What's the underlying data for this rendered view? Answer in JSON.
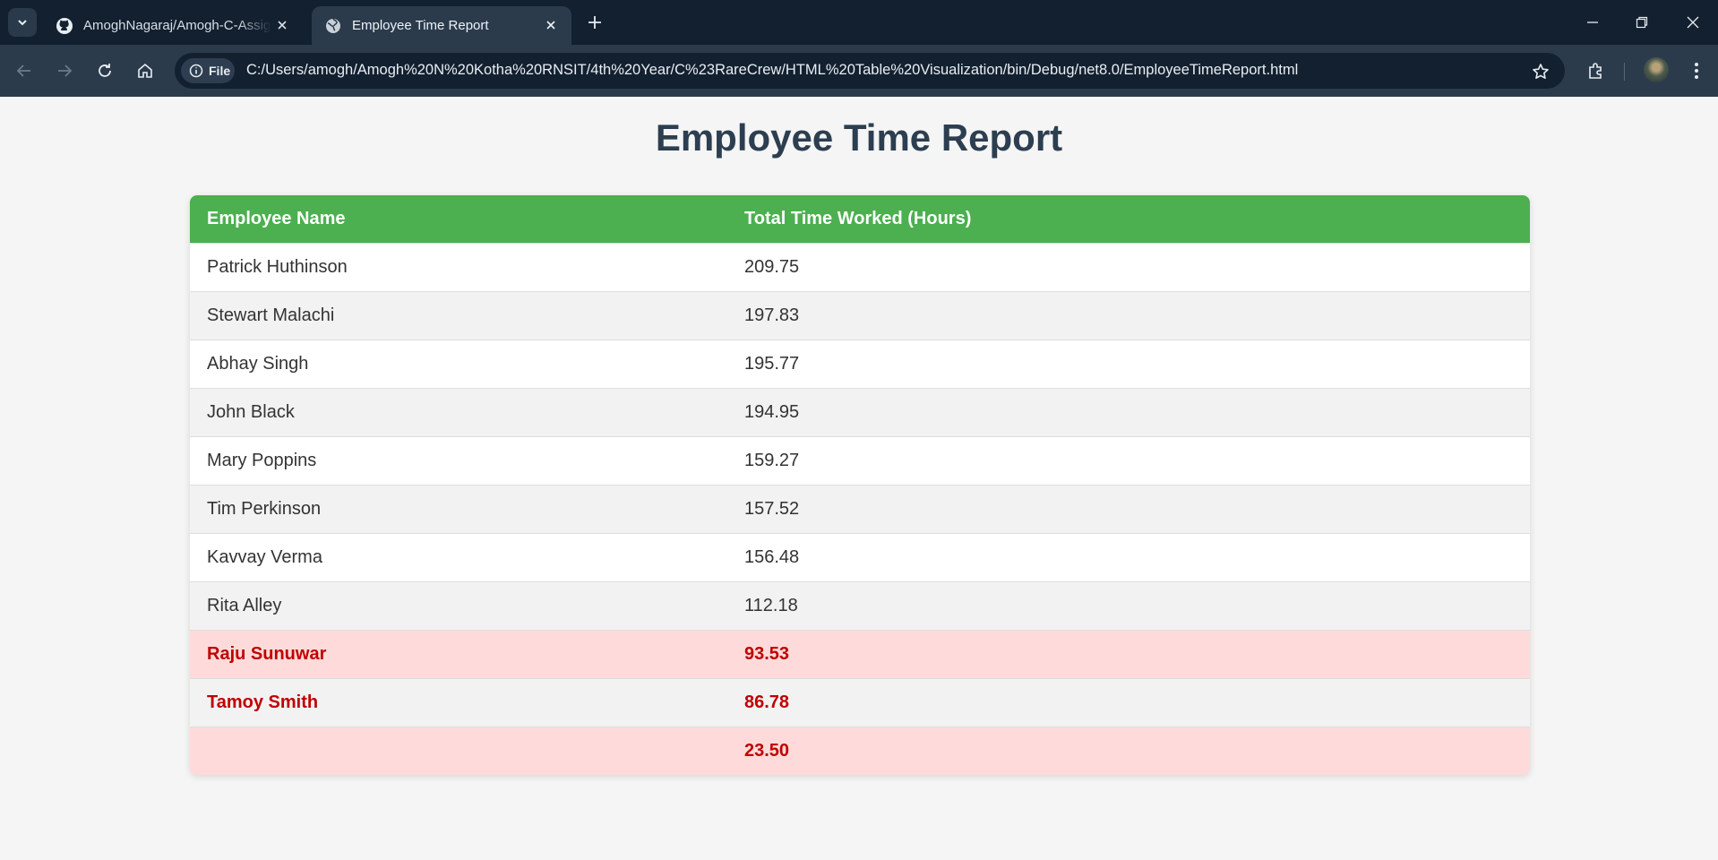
{
  "browser": {
    "tabs": [
      {
        "title": "AmoghNagaraj/Amogh-C-Assignment",
        "active": false,
        "icon": "github-icon"
      },
      {
        "title": "Employee Time Report",
        "active": true,
        "icon": "globe-icon"
      }
    ],
    "site_chip": "File",
    "url": "C:/Users/amogh/Amogh%20N%20Kotha%20RNSIT/4th%20Year/C%23RareCrew/HTML%20Table%20Visualization/bin/Debug/net8.0/EmployeeTimeReport.html"
  },
  "page": {
    "title": "Employee Time Report",
    "headers": [
      "Employee Name",
      "Total Time Worked (Hours)"
    ],
    "rows": [
      {
        "name": "Patrick Huthinson",
        "hours": "209.75",
        "highlight": false
      },
      {
        "name": "Stewart Malachi",
        "hours": "197.83",
        "highlight": false
      },
      {
        "name": "Abhay Singh",
        "hours": "195.77",
        "highlight": false
      },
      {
        "name": "John Black",
        "hours": "194.95",
        "highlight": false
      },
      {
        "name": "Mary Poppins",
        "hours": "159.27",
        "highlight": false
      },
      {
        "name": "Tim Perkinson",
        "hours": "157.52",
        "highlight": false
      },
      {
        "name": "Kavvay Verma",
        "hours": "156.48",
        "highlight": false
      },
      {
        "name": "Rita Alley",
        "hours": "112.18",
        "highlight": false
      },
      {
        "name": "Raju Sunuwar",
        "hours": "93.53",
        "highlight": true
      },
      {
        "name": "Tamoy Smith",
        "hours": "86.78",
        "highlight": true
      },
      {
        "name": "",
        "hours": "23.50",
        "highlight": true
      }
    ]
  },
  "colors": {
    "header_bg": "#4caf50",
    "highlight_bg": "#ffdada",
    "highlight_text": "#c00000",
    "title_text": "#2c3e50"
  }
}
